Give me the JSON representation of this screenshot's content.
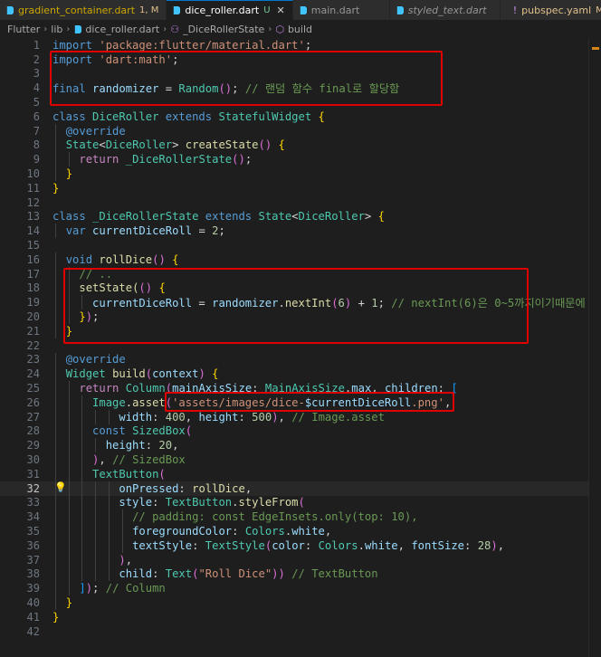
{
  "tabs": [
    {
      "label": "gradient_container.dart",
      "badge": "1, M",
      "active": false
    },
    {
      "label": "dice_roller.dart",
      "badge": "U",
      "active": true
    },
    {
      "label": "main.dart",
      "badge": "",
      "active": false
    },
    {
      "label": "styled_text.dart",
      "badge": "",
      "active": false
    },
    {
      "label": "pubspec.yaml",
      "badge": "M",
      "active": false
    }
  ],
  "breadcrumb": [
    "Flutter",
    "lib",
    "dice_roller.dart",
    "_DiceRollerState",
    "build"
  ],
  "current_line": 32,
  "colors": {
    "accent": "#0078d4",
    "highlight_box": "#e00000",
    "background": "#1e1e1e"
  },
  "code_lines": [
    "import 'package:flutter/material.dart';",
    "import 'dart:math';",
    "",
    "final randomizer = Random(); // 랜덤 함수 final로 할당함",
    "",
    "class DiceRoller extends StatefulWidget {",
    "  @override",
    "  State<DiceRoller> createState() {",
    "    return _DiceRollerState();",
    "  }",
    "}",
    "",
    "class _DiceRollerState extends State<DiceRoller> {",
    "  var currentDiceRoll = 2;",
    "",
    "  void rollDice() {",
    "    // ..",
    "    setState(() {",
    "      currentDiceRoll = randomizer.nextInt(6) + 1; // nextInt(6)은 0~5까지이기때문에",
    "    });",
    "  }",
    "",
    "  @override",
    "  Widget build(context) {",
    "    return Column(mainAxisSize: MainAxisSize.max, children: [",
    "      Image.asset('assets/images/dice-$currentDiceRoll.png',",
    "          width: 400, height: 500), // Image.asset",
    "      const SizedBox(",
    "        height: 20,",
    "      ), // SizedBox",
    "      TextButton(",
    "          onPressed: rollDice,",
    "          style: TextButton.styleFrom(",
    "            // padding: const EdgeInsets.only(top: 10),",
    "            foregroundColor: Colors.white,",
    "            textStyle: TextStyle(color: Colors.white, fontSize: 28),",
    "          ),",
    "          child: Text(\"Roll Dice\")) // TextButton",
    "    ]); // Column",
    "  }",
    "}",
    ""
  ]
}
